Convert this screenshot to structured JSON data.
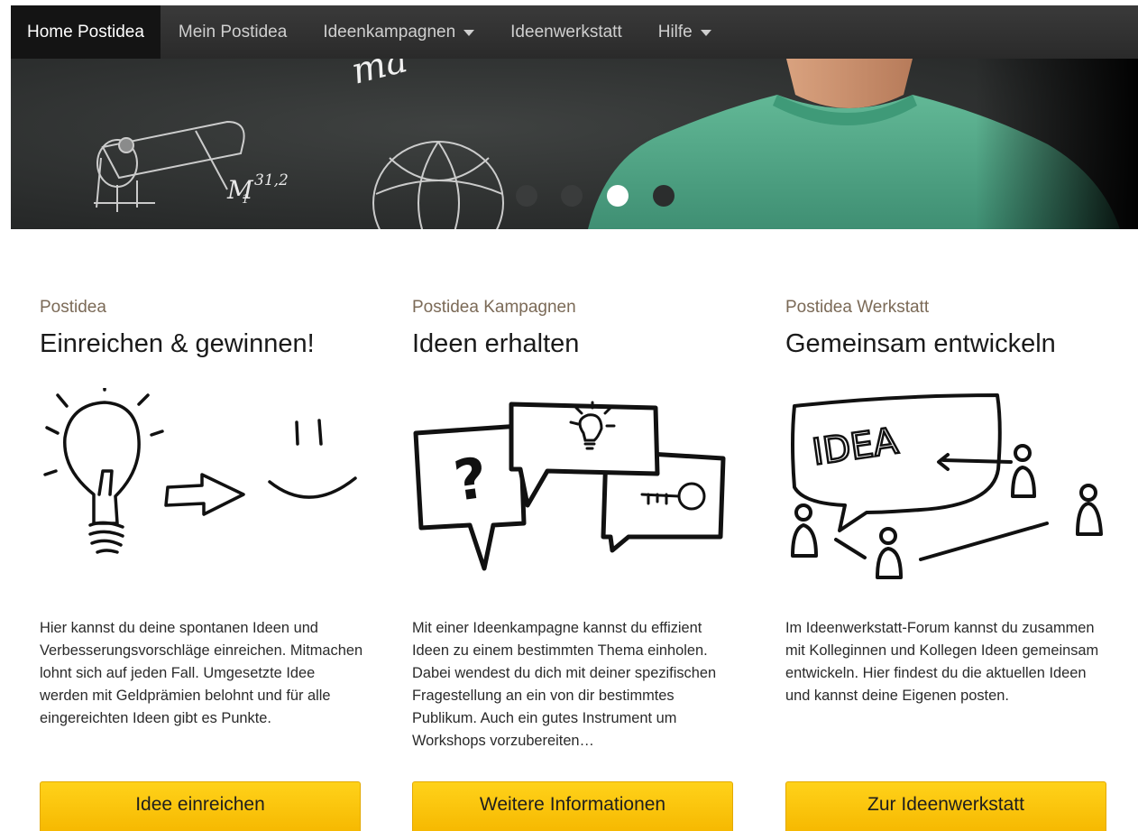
{
  "nav": {
    "items": [
      {
        "label": "Home Postidea",
        "active": true
      },
      {
        "label": "Mein Postidea"
      },
      {
        "label": "Ideenkampagnen",
        "dropdown": true
      },
      {
        "label": "Ideenwerkstatt"
      },
      {
        "label": "Hilfe",
        "dropdown": true
      }
    ]
  },
  "hero": {
    "chalk_text_top": "ma",
    "chalk_formula": "M",
    "chalk_formula_sub": "1",
    "chalk_formula_sup": "31,2",
    "carousel": {
      "slides": 4,
      "active_index": 2
    }
  },
  "columns": [
    {
      "eyebrow": "Postidea",
      "heading": "Einreichen & gewinnen!",
      "illustration": "bulb-arrow-smile-icon",
      "description": "Hier kannst du deine spontanen Ideen und Verbesserungsvorschläge einreichen. Mitmachen lohnt sich auf jeden Fall. Umgesetzte Idee werden mit Geldprämien belohnt und für alle eingereichten Ideen gibt es Punkte.",
      "button": "Idee einreichen"
    },
    {
      "eyebrow": "Postidea Kampagnen",
      "heading": "Ideen erhalten",
      "illustration": "speech-bubbles-icon",
      "description": "Mit einer Ideenkampagne kannst du effizient Ideen zu einem bestimmten Thema einholen. Dabei wendest du dich mit deiner spezifischen Fragestellung an ein von dir bestimmtes Publikum. Auch ein gutes Instrument um Workshops vorzubereiten…",
      "button": "Weitere Informationen"
    },
    {
      "eyebrow": "Postidea Werkstatt",
      "heading": "Gemeinsam entwickeln",
      "illustration": "idea-bubble-people-icon",
      "illustration_text": "IDEA",
      "description": "Im Ideenwerkstatt-Forum kannst du zusammen mit Kolleginnen und Kollegen Ideen gemeinsam entwickeln. Hier findest du die aktuellen Ideen und kannst deine Eigenen posten.",
      "button": "Zur Ideenwerkstatt"
    }
  ],
  "colors": {
    "nav_bg": "#333333",
    "nav_active_bg": "#141414",
    "eyebrow": "#7b6a57",
    "button_yellow": "#ffcc00",
    "shirt": "#5ab08f"
  }
}
